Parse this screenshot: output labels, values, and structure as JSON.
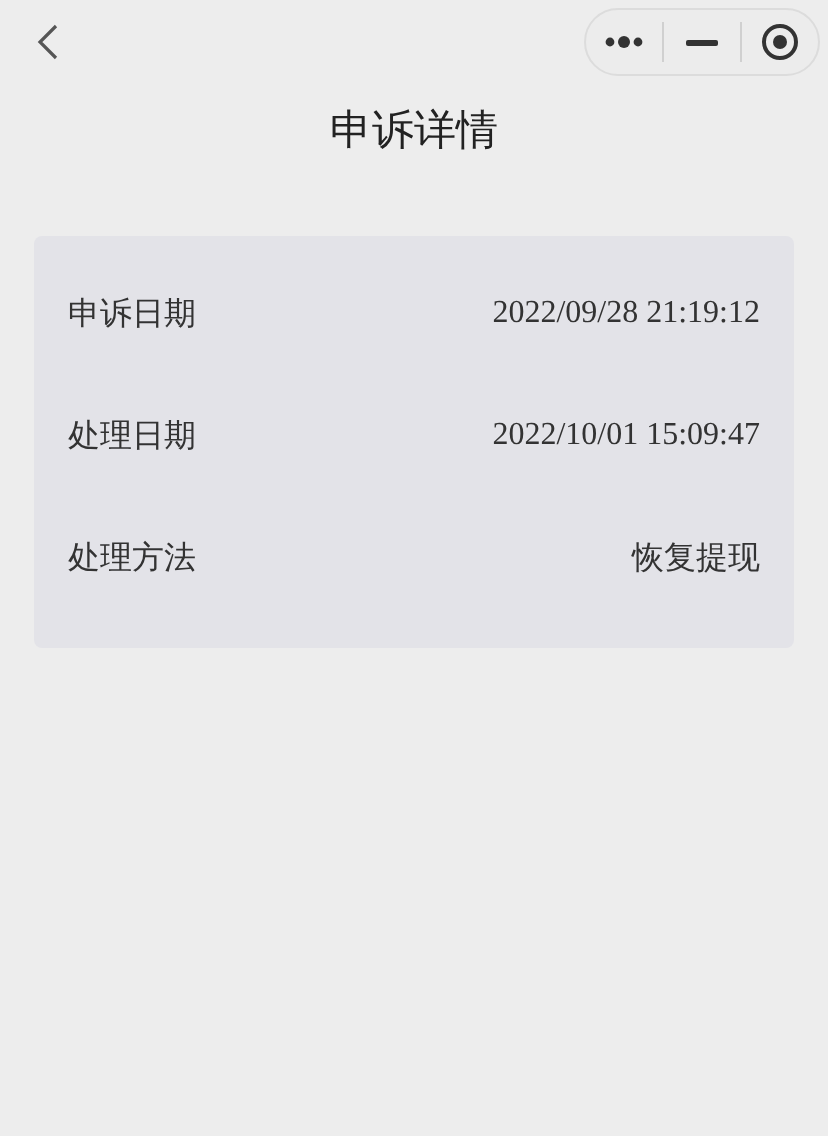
{
  "nav": {
    "title": "申诉详情"
  },
  "details": [
    {
      "label": "申诉日期",
      "value": "2022/09/28 21:19:12",
      "kind": "date"
    },
    {
      "label": "处理日期",
      "value": "2022/10/01 15:09:47",
      "kind": "date"
    },
    {
      "label": "处理方法",
      "value": "恢复提现",
      "kind": "text"
    }
  ]
}
